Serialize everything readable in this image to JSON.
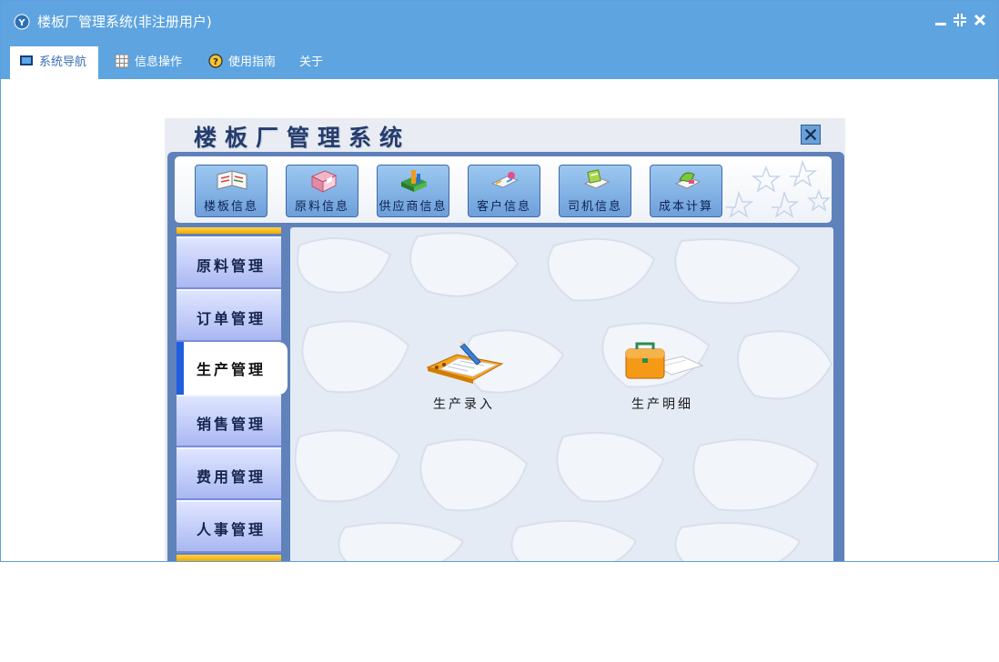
{
  "window": {
    "title": "楼板厂管理系统(非注册用户)"
  },
  "menu": {
    "tabs": [
      {
        "label": "系统导航",
        "icon": "monitor-icon",
        "active": true
      },
      {
        "label": "信息操作",
        "icon": "grid-icon",
        "active": false
      },
      {
        "label": "使用指南",
        "icon": "help-icon",
        "active": false
      },
      {
        "label": "关于",
        "icon": "",
        "active": false
      }
    ]
  },
  "panel": {
    "heading": "楼板厂管理系统",
    "toolbar": [
      {
        "label": "楼板信息",
        "icon": "book-icon"
      },
      {
        "label": "原料信息",
        "icon": "material-box-icon"
      },
      {
        "label": "供应商信息",
        "icon": "supplier-cube-icon"
      },
      {
        "label": "客户信息",
        "icon": "customer-icon"
      },
      {
        "label": "司机信息",
        "icon": "driver-icon"
      },
      {
        "label": "成本计算",
        "icon": "cost-icon"
      }
    ],
    "sidebar": [
      {
        "label": "原料管理",
        "active": false
      },
      {
        "label": "订单管理",
        "active": false
      },
      {
        "label": "生产管理",
        "active": true
      },
      {
        "label": "销售管理",
        "active": false
      },
      {
        "label": "费用管理",
        "active": false
      },
      {
        "label": "人事管理",
        "active": false
      }
    ],
    "features": [
      {
        "label": "生产录入",
        "icon": "notebook-pencil-icon"
      },
      {
        "label": "生产明细",
        "icon": "briefcase-icon"
      }
    ]
  },
  "colors": {
    "titlebar": "#5ea4e0",
    "panel_frame": "#5f82bb",
    "sidebar_active_marker": "#1f5fe0",
    "sidebar_cap": "#f2a900"
  }
}
